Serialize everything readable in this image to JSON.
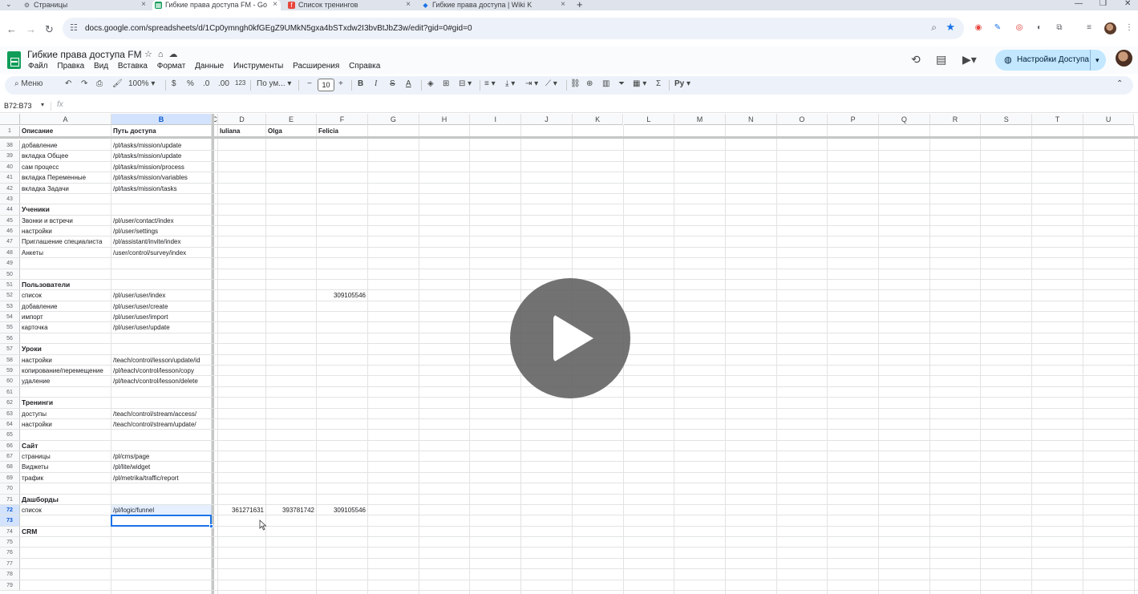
{
  "browser": {
    "tabs": [
      {
        "title": "Страницы",
        "icon": "gear-icon",
        "active": false
      },
      {
        "title": "Гибкие права доступа FM - Go",
        "icon": "sheets-icon",
        "active": true
      },
      {
        "title": "Список тренингов",
        "icon": "form-icon",
        "active": false
      },
      {
        "title": "Гибкие права доступа | Wiki K",
        "icon": "wiki-icon",
        "active": false
      }
    ],
    "url": "docs.google.com/spreadsheets/d/1Cp0ymngh0kfGEgZ9UMkN5gxa4bSTxdw2I3bvBtJbZ3w/edit?gid=0#gid=0"
  },
  "doc": {
    "title": "Гибкие права доступа FM",
    "menus": [
      "Файл",
      "Правка",
      "Вид",
      "Вставка",
      "Формат",
      "Данные",
      "Инструменты",
      "Расширения",
      "Справка"
    ],
    "share_label": "Настройки Доступа"
  },
  "toolbar": {
    "menu_label": "Меню",
    "zoom": "100%",
    "currency": "$",
    "percent": "%",
    "dec_minus": ".0",
    "dec_plus": ".00",
    "number_format": "123",
    "font": "По ум...",
    "font_size": "10"
  },
  "formula_bar": {
    "name_box": "B72:B73",
    "fx": "fx"
  },
  "grid": {
    "columns": [
      "A",
      "B",
      "C",
      "D",
      "E",
      "F",
      "G",
      "H",
      "I",
      "J",
      "K",
      "L",
      "M",
      "N",
      "O",
      "P",
      "Q",
      "R",
      "S",
      "T",
      "U"
    ],
    "header_row": {
      "num": "1",
      "A": "Описание",
      "B": "Путь доступа",
      "D": "Iuliana",
      "E": "Olga",
      "F": "Felicia"
    },
    "rows": [
      {
        "num": "38",
        "A": "добавление",
        "B": "/pl/tasks/mission/update"
      },
      {
        "num": "39",
        "A": "вкладка Общее",
        "B": "/pl/tasks/mission/update"
      },
      {
        "num": "40",
        "A": "сам процесс",
        "B": "/pl/tasks/mission/process"
      },
      {
        "num": "41",
        "A": "вкладка Переменные",
        "B": "/pl/tasks/mission/variables"
      },
      {
        "num": "42",
        "A": "вкладка Задачи",
        "B": "/pl/tasks/mission/tasks"
      },
      {
        "num": "43"
      },
      {
        "num": "44",
        "A": "Ученики",
        "bold": true
      },
      {
        "num": "45",
        "A": "Звонки и встречи",
        "B": "/pl/user/contact/index"
      },
      {
        "num": "46",
        "A": "настройки",
        "B": "/pl/user/settings"
      },
      {
        "num": "47",
        "A": "Приглашение специалиста",
        "B": "/pl/assistant/invite/index"
      },
      {
        "num": "48",
        "A": "Анкеты",
        "B": "/user/control/survey/index"
      },
      {
        "num": "49"
      },
      {
        "num": "50"
      },
      {
        "num": "51",
        "A": "Пользователи",
        "bold": true
      },
      {
        "num": "52",
        "A": "список",
        "B": "/pl/user/user/index",
        "F": "309105546"
      },
      {
        "num": "53",
        "A": "добавление",
        "B": "/pl/user/user/create"
      },
      {
        "num": "54",
        "A": "импорт",
        "B": "/pl/user/user/import"
      },
      {
        "num": "55",
        "A": "карточка",
        "B": "/pl/user/user/update"
      },
      {
        "num": "56"
      },
      {
        "num": "57",
        "A": "Уроки",
        "bold": true
      },
      {
        "num": "58",
        "A": "настройки",
        "B": "/teach/control/lesson/update/id"
      },
      {
        "num": "59",
        "A": "копирование/перемещение",
        "B": "/pl/teach/control/lesson/copy"
      },
      {
        "num": "60",
        "A": "удаление",
        "B": "/pl/teach/control/lesson/delete"
      },
      {
        "num": "61"
      },
      {
        "num": "62",
        "A": "Тренинги",
        "bold": true
      },
      {
        "num": "63",
        "A": "доступы",
        "B": "/teach/control/stream/access/"
      },
      {
        "num": "64",
        "A": "настройки",
        "B": "/teach/control/stream/update/"
      },
      {
        "num": "65"
      },
      {
        "num": "66",
        "A": "Сайт",
        "bold": true
      },
      {
        "num": "67",
        "A": "страницы",
        "B": "/pl/cms/page"
      },
      {
        "num": "68",
        "A": "Виджеты",
        "B": "/pl/lite/widget"
      },
      {
        "num": "69",
        "A": "трафик",
        "B": "/pl/metrika/traffic/report"
      },
      {
        "num": "70"
      },
      {
        "num": "71",
        "A": "Дашборды",
        "bold": true
      },
      {
        "num": "72",
        "A": "список",
        "B": "/pl/logic/funnel",
        "D": "361271631",
        "E": "393781742",
        "F": "309105546"
      },
      {
        "num": "73"
      },
      {
        "num": "74",
        "A": "CRM",
        "bold": true
      },
      {
        "num": "75"
      },
      {
        "num": "76"
      },
      {
        "num": "77"
      },
      {
        "num": "78"
      },
      {
        "num": "79"
      }
    ]
  },
  "colors": {
    "accent": "#1a73e8",
    "selection": "#d3e3fd",
    "share_button": "#c2e7ff",
    "sheets_green": "#0f9d58"
  }
}
